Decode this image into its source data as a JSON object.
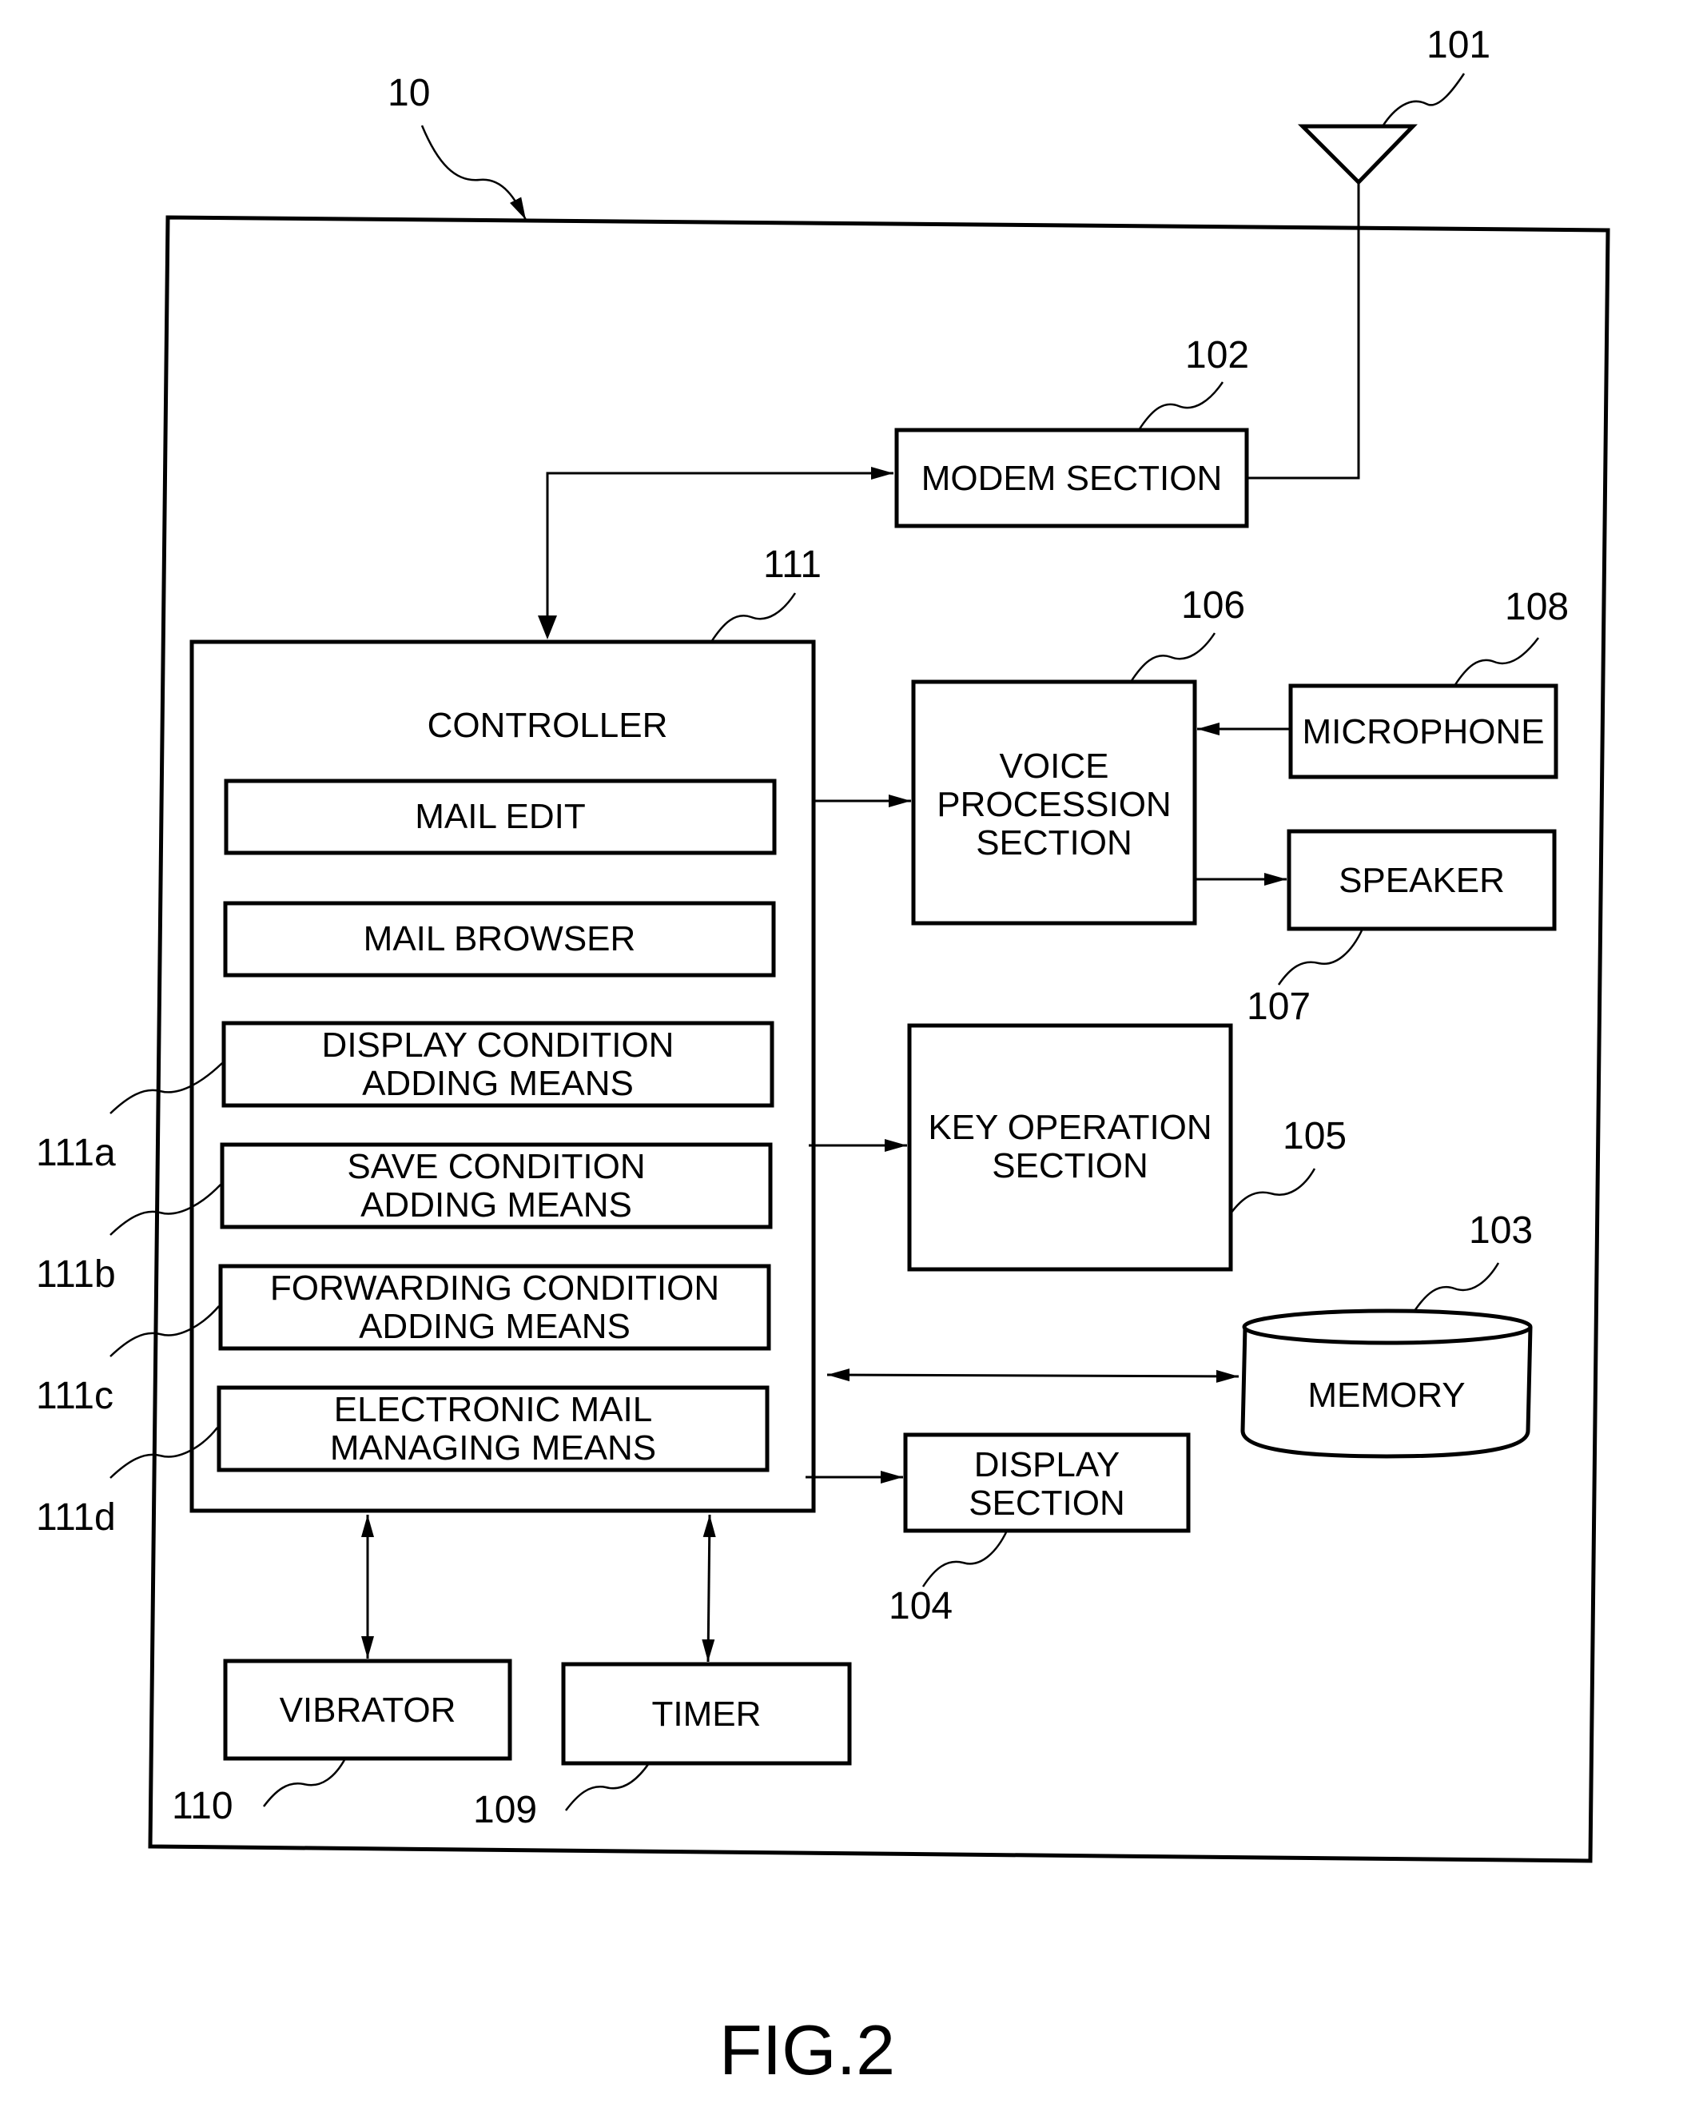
{
  "figure": {
    "caption": "FIG.2",
    "device_ref": "10"
  },
  "antenna": {
    "ref": "101"
  },
  "modem": {
    "ref": "102",
    "label": "MODEM SECTION"
  },
  "controller": {
    "ref": "111",
    "title": "CONTROLLER",
    "modules": [
      {
        "lines": [
          "MAIL EDIT"
        ],
        "ref": ""
      },
      {
        "lines": [
          "MAIL BROWSER"
        ],
        "ref": ""
      },
      {
        "lines": [
          "DISPLAY CONDITION",
          "ADDING MEANS"
        ],
        "ref": "111a"
      },
      {
        "lines": [
          "SAVE CONDITION",
          "ADDING MEANS"
        ],
        "ref": "111b"
      },
      {
        "lines": [
          "FORWARDING CONDITION",
          "ADDING MEANS"
        ],
        "ref": "111c"
      },
      {
        "lines": [
          "ELECTRONIC MAIL",
          "MANAGING MEANS"
        ],
        "ref": "111d"
      }
    ]
  },
  "voice": {
    "ref": "106",
    "lines": [
      "VOICE",
      "PROCESSION",
      "SECTION"
    ]
  },
  "microphone": {
    "ref": "108",
    "label": "MICROPHONE"
  },
  "speaker": {
    "ref": "107",
    "label": "SPEAKER"
  },
  "key_operation": {
    "ref": "105",
    "lines": [
      "KEY OPERATION",
      "SECTION"
    ]
  },
  "memory": {
    "ref": "103",
    "label": "MEMORY"
  },
  "display": {
    "ref": "104",
    "lines": [
      "DISPLAY",
      "SECTION"
    ]
  },
  "vibrator": {
    "ref": "110",
    "label": "VIBRATOR"
  },
  "timer": {
    "ref": "109",
    "label": "TIMER"
  }
}
